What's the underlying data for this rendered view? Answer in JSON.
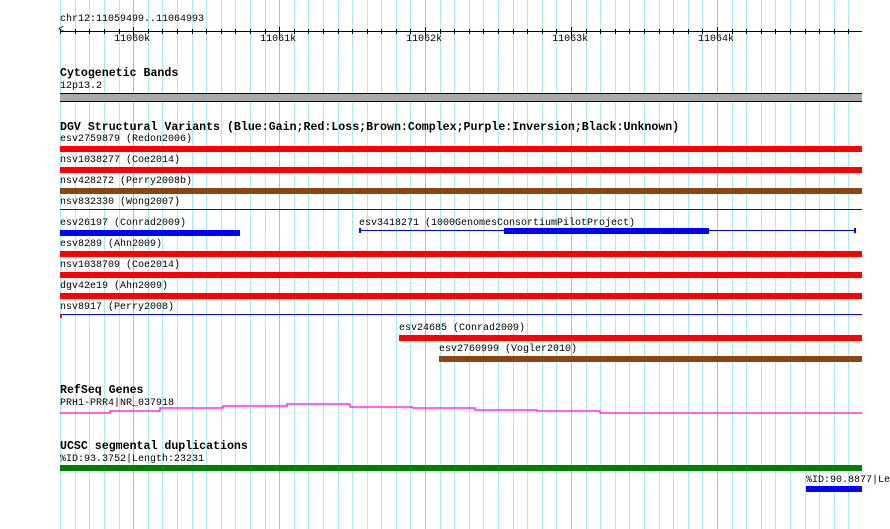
{
  "region": {
    "label": "chr12:11059499..11064993",
    "start": 11059499,
    "end": 11064993,
    "ticks": [
      "11060k",
      "11061k",
      "11062k",
      "11063k",
      "11064k"
    ]
  },
  "colors": {
    "gain": "#0000ff",
    "loss": "#ff0000",
    "complex": "#8b4513",
    "cyto": "#aaaaaa",
    "refseq": "#ff00ff",
    "segdup_high": "#008000",
    "segdup_low": "#0000ff"
  },
  "tracks": {
    "cyto": {
      "title": "Cytogenetic Bands",
      "band": "12p13.2"
    },
    "dgv": {
      "title": "DGV Structural Variants (Blue:Gain;Red:Loss;Brown:Complex;Purple:Inversion;Black:Unknown)",
      "rows": [
        [
          {
            "label": "esv2759879 (Redon2006)",
            "type": "loss",
            "start": 11059499,
            "end": 11064993
          }
        ],
        [
          {
            "label": "nsv1038277 (Coe2014)",
            "type": "loss",
            "start": 11059499,
            "end": 11064993
          }
        ],
        [
          {
            "label": "nsv428272 (Perry2008b)",
            "type": "complex",
            "start": 11059499,
            "end": 11064993
          }
        ],
        [
          {
            "label": "nsv832330 (Wong2007)",
            "type": "gain",
            "thin": true,
            "start": 11059499,
            "end": 11064993
          }
        ],
        [
          {
            "label": "esv26197 (Conrad2009)",
            "type": "gain",
            "start": 11059499,
            "end": 11060732
          },
          {
            "label": "esv3418271 (1000GenomesConsortiumPilotProject)",
            "type": "gain",
            "thin": true,
            "start": 11061547,
            "end": 11064951,
            "thickStart": 11062540,
            "thickEnd": 11063944
          }
        ],
        [
          {
            "label": "esv8289 (Ahn2009)",
            "type": "loss",
            "start": 11059499,
            "end": 11064993
          }
        ],
        [
          {
            "label": "nsv1038709 (Coe2014)",
            "type": "loss",
            "start": 11059499,
            "end": 11064993
          }
        ],
        [
          {
            "label": "dgv42e19 (Ahn2009)",
            "type": "loss",
            "start": 11059499,
            "end": 11064993
          }
        ],
        [
          {
            "label": "nsv8917 (Perry2008)",
            "type": "gain",
            "thin": true,
            "start": 11059499,
            "end": 11064993
          }
        ],
        [
          {
            "label": "esv24685 (Conrad2009)",
            "type": "loss",
            "start": 11061821,
            "end": 11064993
          }
        ],
        [
          {
            "label": "esv2760999 (Vogler2010)",
            "type": "complex",
            "start": 11062095,
            "end": 11064993
          }
        ]
      ]
    },
    "refseq": {
      "title": "RefSeq Genes",
      "gene": "PRH1-PRR4|NR_037918"
    },
    "segdup": {
      "title": "UCSC segmental duplications",
      "items": [
        {
          "label": "%ID:93.3752|Length:23231",
          "level": "high",
          "start": 11059499,
          "end": 11064993
        },
        {
          "label": "%ID:90.8877|Le",
          "level": "low",
          "start": 11064609,
          "end": 11064993
        }
      ]
    }
  }
}
